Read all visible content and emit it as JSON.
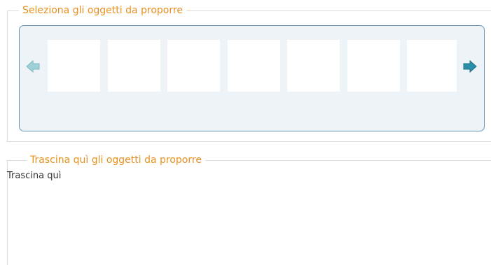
{
  "select_section": {
    "legend": "Seleziona gli oggetti da proporre",
    "left_arrow_icon": "arrow-left-icon",
    "right_arrow_icon": "arrow-right-icon",
    "slot_count": 7
  },
  "drop_section": {
    "legend": "Trascina quì gli oggetti da proporre",
    "placeholder": "Trascina quì"
  },
  "colors": {
    "legend": "#e8901e",
    "carousel_bg": "#eef3f7",
    "carousel_border": "#6e97b4",
    "arrow_inactive": "#9fd0d8",
    "arrow_active": "#2a8fa8"
  }
}
